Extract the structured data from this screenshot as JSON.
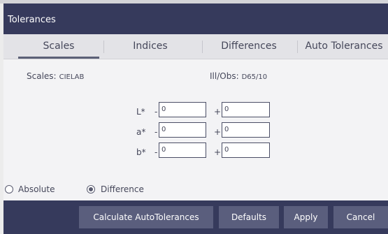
{
  "window": {
    "title": "Tolerances"
  },
  "tabs": [
    {
      "label": "Scales",
      "active": true
    },
    {
      "label": "Indices",
      "active": false
    },
    {
      "label": "Differences",
      "active": false
    },
    {
      "label": "Auto Tolerances",
      "active": false
    }
  ],
  "info": {
    "scales_label": "Scales:",
    "scales_value": "CIELAB",
    "illobs_label": "Ill/Obs:",
    "illobs_value": "D65/10"
  },
  "tolerances": [
    {
      "label": "L*",
      "minus_sign": "-",
      "minus_value": "0",
      "plus_sign": "+",
      "plus_value": "0"
    },
    {
      "label": "a*",
      "minus_sign": "-",
      "minus_value": "0",
      "plus_sign": "+",
      "plus_value": "0"
    },
    {
      "label": "b*",
      "minus_sign": "-",
      "minus_value": "0",
      "plus_sign": "+",
      "plus_value": "0"
    }
  ],
  "mode": {
    "absolute_label": "Absolute",
    "difference_label": "Difference",
    "selected": "Difference"
  },
  "buttons": {
    "calculate": "Calculate AutoTolerances",
    "defaults": "Defaults",
    "apply": "Apply",
    "cancel": "Cancel"
  },
  "colors": {
    "titlebar": "#363a5c",
    "button": "#5a5e7d",
    "background": "#f3f3f5",
    "tabbar": "#e3e3e7"
  }
}
